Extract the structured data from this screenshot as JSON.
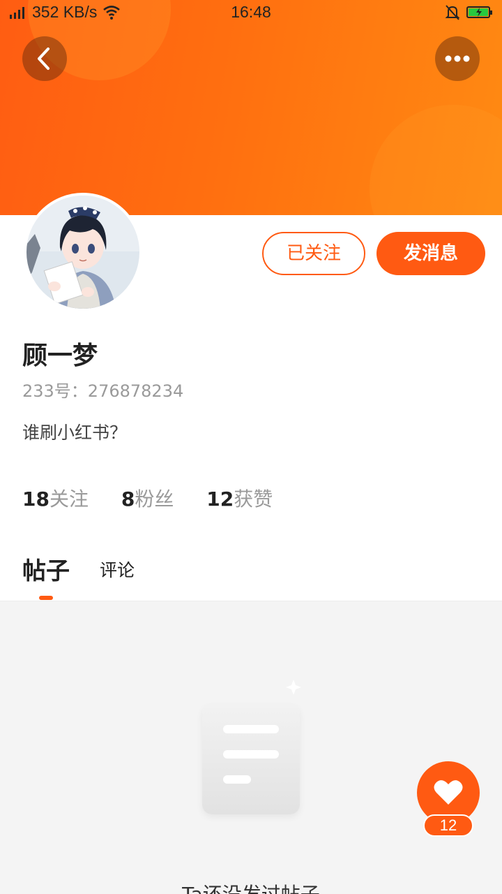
{
  "status_bar": {
    "network_speed": "352 KB/s",
    "time": "16:48"
  },
  "profile": {
    "name": "顾一梦",
    "id_line": "233号：276878234",
    "bio": "谁刷小红书？",
    "follow_button": "已关注",
    "message_button": "发消息"
  },
  "stats": [
    {
      "count": "18",
      "label": "关注"
    },
    {
      "count": "8",
      "label": "粉丝"
    },
    {
      "count": "12",
      "label": "获赞"
    }
  ],
  "tabs": {
    "posts": "帖子",
    "comments": "评论"
  },
  "empty_state": {
    "text": "Ta还没发过帖子"
  },
  "like_badge": {
    "count": "12"
  },
  "colors": {
    "accent": "#ff5a12",
    "header_start": "#ff5d12",
    "header_end": "#ff8a12"
  }
}
